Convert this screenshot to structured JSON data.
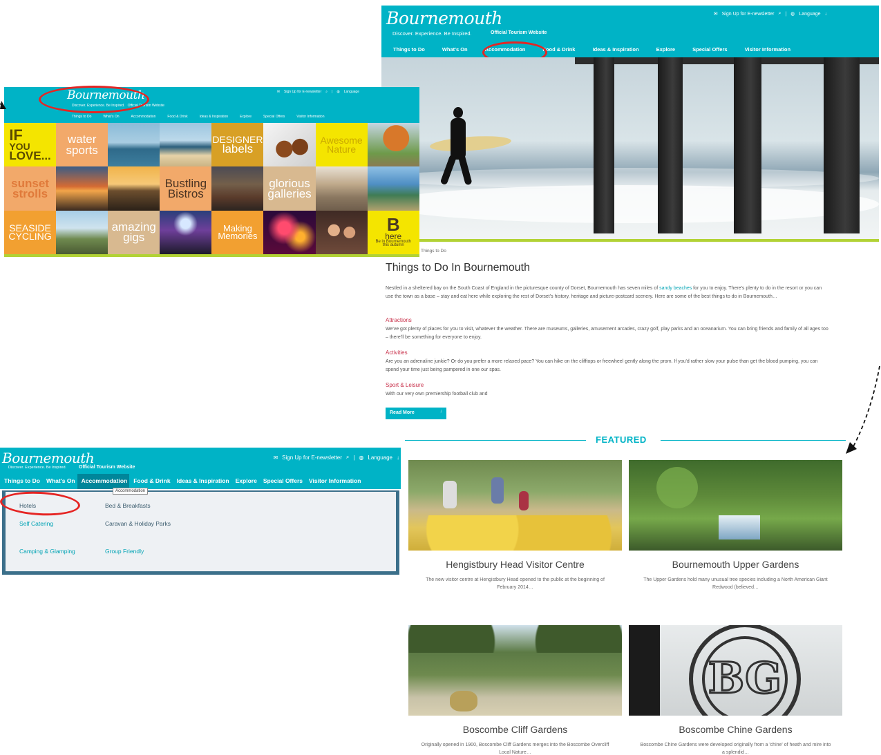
{
  "brand": {
    "logo": "Bournemouth",
    "tagline": "Discover. Experience. Be Inspired.",
    "official": "Official Tourism Website"
  },
  "util": {
    "signup": "Sign Up for E-newsletter",
    "language": "Language"
  },
  "nav": [
    "Things to Do",
    "What's On",
    "Accommodation",
    "Food & Drink",
    "Ideas & Inspiration",
    "Explore",
    "Special Offers",
    "Visitor Information"
  ],
  "panel_a": {
    "breadcrumb": "Things to Do",
    "title": "Things to Do In Bournemouth",
    "intro_before": "Nestled in a sheltered bay on the South Coast of England in the picturesque county of Dorset, Bournemouth has seven miles of ",
    "intro_link": "sandy beaches",
    "intro_after": " for you to enjoy. There's plenty to do in the resort or you can use the town as a base – stay and eat here while exploring the rest of Dorset's history, heritage and picture-postcard scenery. Here are some of the best things to do in Bournemouth…",
    "sections": [
      {
        "heading": "Attractions",
        "text": "We've got plenty of places for you to visit, whatever the weather. There are museums, galleries, amusement arcades, crazy golf, play parks and an oceanarium. You can bring friends and family of all ages too – there'll be something for everyone to enjoy."
      },
      {
        "heading": "Activities",
        "text": "Are you an adrenaline junkie? Or do you prefer a more relaxed pace? You can hike on the clifftops or freewheel gently along the prom. If you'd rather slow your pulse than get the blood pumping, you can spend your time just being pampered in one our spas."
      },
      {
        "heading": "Sport & Leisure",
        "text": "With our very own premiership football club and"
      }
    ],
    "read_more": "Read More",
    "featured_label": "FEATURED",
    "cards": [
      {
        "title": "Hengistbury Head Visitor Centre",
        "desc": "The new visitor centre at Hengistbury Head opened to the public at the beginning of February 2014…"
      },
      {
        "title": "Bournemouth Upper Gardens",
        "desc": "The Upper Gardens hold many unusual tree species including a North American Giant Redwood (believed…"
      },
      {
        "title": "Boscombe Cliff Gardens",
        "desc": "Originally opened in 1900, Boscombe Cliff Gardens merges into the Boscombe Overcliff Local Nature…"
      },
      {
        "title": "Boscombe Chine Gardens",
        "desc": "Boscombe Chine Gardens were developed originally from a 'chine' of heath and mire into a splendid…"
      }
    ]
  },
  "panel_b": {
    "tiles": [
      {
        "lines": [
          "IF",
          "YOU",
          "LOVE..."
        ],
        "bg": "#f4e500",
        "color": "#5a4a00"
      },
      {
        "lines": [
          "water",
          "sports"
        ],
        "bg": "#f2a96a",
        "color": "#ffffff"
      },
      {
        "lines": [],
        "bg": "photo-windsurf"
      },
      {
        "lines": [],
        "bg": "photo-beach"
      },
      {
        "lines": [
          "DESIGNER",
          "labels"
        ],
        "bg": "#d8a025",
        "color": "#ffffff"
      },
      {
        "lines": [],
        "bg": "photo-shoes"
      },
      {
        "lines": [
          "Awesome",
          "Nature"
        ],
        "bg": "#f4e500",
        "color": "#c9a800"
      },
      {
        "lines": [],
        "bg": "photo-tree"
      },
      {
        "lines": [
          "sunset",
          "strolls"
        ],
        "bg": "#f2a96a",
        "color": "#e07a3a"
      },
      {
        "lines": [],
        "bg": "photo-sunset"
      },
      {
        "lines": [],
        "bg": "photo-pier"
      },
      {
        "lines": [
          "Bustling",
          "Bistros"
        ],
        "bg": "#f2a96a",
        "color": "#4a3322"
      },
      {
        "lines": [],
        "bg": "photo-bistro"
      },
      {
        "lines": [
          "glorious",
          "galleries"
        ],
        "bg": "#d8b990",
        "color": "#ffffff"
      },
      {
        "lines": [],
        "bg": "photo-gallery"
      },
      {
        "lines": [],
        "bg": "photo-coast"
      },
      {
        "lines": [
          "SEASIDE",
          "CYCLING"
        ],
        "bg": "#f2a031",
        "color": "#ffffff"
      },
      {
        "lines": [],
        "bg": "photo-bikes"
      },
      {
        "lines": [
          "amazing",
          "gigs"
        ],
        "bg": "#d8b990",
        "color": "#ffffff"
      },
      {
        "lines": [],
        "bg": "photo-gig"
      },
      {
        "lines": [
          "Making",
          "Memories"
        ],
        "bg": "#f2a031",
        "color": "#ffffff"
      },
      {
        "lines": [],
        "bg": "photo-fireworks"
      },
      {
        "lines": [],
        "bg": "photo-people"
      },
      {
        "lines": [
          "B",
          "here",
          "Be in Bournemouth",
          "this autumn"
        ],
        "bg": "#f4e500",
        "color": "#4a3a22"
      }
    ]
  },
  "panel_c": {
    "tooltip": "Accommodation",
    "menu": [
      {
        "label": "Hotels"
      },
      {
        "label": "Self Catering"
      },
      {
        "label": "Camping & Glamping"
      },
      {
        "label": "Bed & Breakfasts"
      },
      {
        "label": "Caravan & Holiday Parks"
      },
      {
        "label": "Group Friendly"
      }
    ]
  },
  "colors": {
    "teal": "#00b3c6",
    "lime": "#b2d235",
    "heading_red": "#c8304a",
    "annotation_red": "#e52523"
  }
}
